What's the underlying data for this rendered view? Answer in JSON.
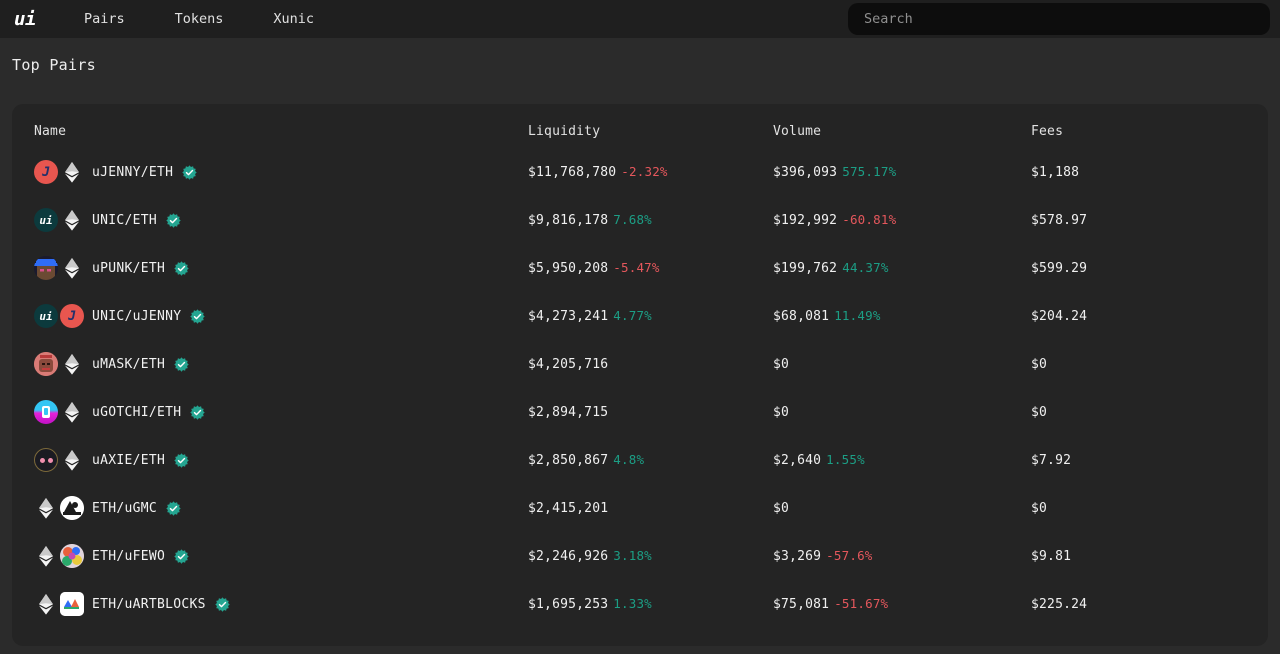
{
  "nav": {
    "brand": "ui",
    "links": [
      {
        "label": "Pairs",
        "name": "nav-link-pairs"
      },
      {
        "label": "Tokens",
        "name": "nav-link-tokens"
      },
      {
        "label": "Xunic",
        "name": "nav-link-xunic"
      }
    ],
    "search": {
      "value": "",
      "placeholder": "Search"
    }
  },
  "page": {
    "title": "Top Pairs"
  },
  "colors": {
    "page_bg": "#2b2b2b",
    "nav_bg": "#1f1f1f",
    "card_bg": "#242424",
    "search_bg": "#0d0d0d",
    "text": "#f0f0f0",
    "up": "#1c9e85",
    "down": "#e4575c",
    "verified_badge": "#24a591"
  },
  "table": {
    "columns": [
      "Name",
      "Liquidity",
      "Volume",
      "Fees"
    ],
    "rows": [
      {
        "pair": "uJENNY/ETH",
        "verified": true,
        "icons": [
          "jenny",
          "eth"
        ],
        "liquidity": "$11,768,780",
        "liquidity_change": "-2.32%",
        "liquidity_dir": "down",
        "volume": "$396,093",
        "volume_change": "575.17%",
        "volume_dir": "up",
        "fees": "$1,188"
      },
      {
        "pair": "UNIC/ETH",
        "verified": true,
        "icons": [
          "unic",
          "eth"
        ],
        "liquidity": "$9,816,178",
        "liquidity_change": "7.68%",
        "liquidity_dir": "up",
        "volume": "$192,992",
        "volume_change": "-60.81%",
        "volume_dir": "down",
        "fees": "$578.97"
      },
      {
        "pair": "uPUNK/ETH",
        "verified": true,
        "icons": [
          "punk",
          "eth"
        ],
        "liquidity": "$5,950,208",
        "liquidity_change": "-5.47%",
        "liquidity_dir": "down",
        "volume": "$199,762",
        "volume_change": "44.37%",
        "volume_dir": "up",
        "fees": "$599.29"
      },
      {
        "pair": "UNIC/uJENNY",
        "verified": true,
        "icons": [
          "unic",
          "jenny"
        ],
        "liquidity": "$4,273,241",
        "liquidity_change": "4.77%",
        "liquidity_dir": "up",
        "volume": "$68,081",
        "volume_change": "11.49%",
        "volume_dir": "up",
        "fees": "$204.24"
      },
      {
        "pair": "uMASK/ETH",
        "verified": true,
        "icons": [
          "mask",
          "eth"
        ],
        "liquidity": "$4,205,716",
        "liquidity_change": "",
        "liquidity_dir": "",
        "volume": "$0",
        "volume_change": "",
        "volume_dir": "",
        "fees": "$0"
      },
      {
        "pair": "uGOTCHI/ETH",
        "verified": true,
        "icons": [
          "gotchi",
          "eth"
        ],
        "liquidity": "$2,894,715",
        "liquidity_change": "",
        "liquidity_dir": "",
        "volume": "$0",
        "volume_change": "",
        "volume_dir": "",
        "fees": "$0"
      },
      {
        "pair": "uAXIE/ETH",
        "verified": true,
        "icons": [
          "axie",
          "eth"
        ],
        "liquidity": "$2,850,867",
        "liquidity_change": "4.8%",
        "liquidity_dir": "up",
        "volume": "$2,640",
        "volume_change": "1.55%",
        "volume_dir": "up",
        "fees": "$7.92"
      },
      {
        "pair": "ETH/uGMC",
        "verified": true,
        "icons": [
          "eth",
          "gmc"
        ],
        "liquidity": "$2,415,201",
        "liquidity_change": "",
        "liquidity_dir": "",
        "volume": "$0",
        "volume_change": "",
        "volume_dir": "",
        "fees": "$0"
      },
      {
        "pair": "ETH/uFEWO",
        "verified": true,
        "icons": [
          "eth",
          "fewo"
        ],
        "liquidity": "$2,246,926",
        "liquidity_change": "3.18%",
        "liquidity_dir": "up",
        "volume": "$3,269",
        "volume_change": "-57.6%",
        "volume_dir": "down",
        "fees": "$9.81"
      },
      {
        "pair": "ETH/uARTBLOCKS",
        "verified": true,
        "icons": [
          "eth",
          "artblocks"
        ],
        "liquidity": "$1,695,253",
        "liquidity_change": "1.33%",
        "liquidity_dir": "up",
        "volume": "$75,081",
        "volume_change": "-51.67%",
        "volume_dir": "down",
        "fees": "$225.24"
      }
    ]
  }
}
